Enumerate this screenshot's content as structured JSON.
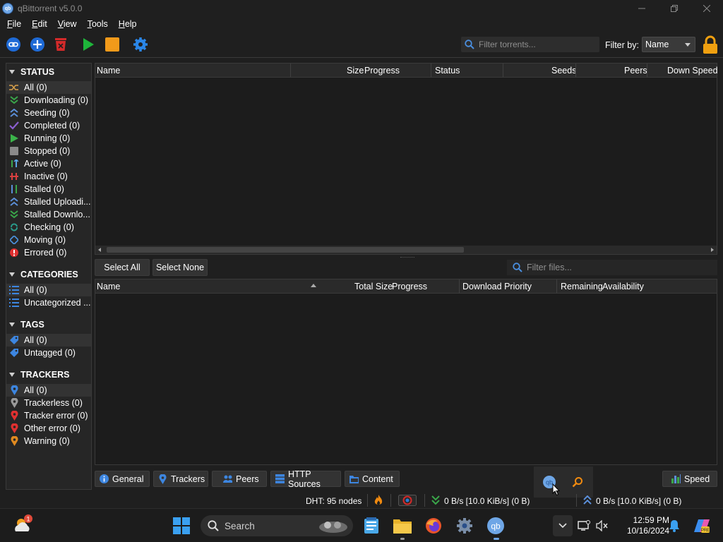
{
  "window": {
    "title": "qBittorrent v5.0.0",
    "logo_text": "qb"
  },
  "menu": [
    "File",
    "Edit",
    "View",
    "Tools",
    "Help"
  ],
  "toolbar": {
    "search_placeholder": "Filter torrents...",
    "filter_label": "Filter by:",
    "filter_value": "Name"
  },
  "sidebar": {
    "status_title": "STATUS",
    "status_items": [
      {
        "label": "All (0)",
        "icon": "shuffle-icon",
        "color": "#d8a04a"
      },
      {
        "label": "Downloading (0)",
        "icon": "download-chevrons-icon",
        "color": "#3aa64a"
      },
      {
        "label": "Seeding (0)",
        "icon": "upload-chevrons-icon",
        "color": "#5b8fd9"
      },
      {
        "label": "Completed (0)",
        "icon": "checkmark-icon",
        "color": "#8b5fd0"
      },
      {
        "label": "Running (0)",
        "icon": "play-icon",
        "color": "#3bb34a"
      },
      {
        "label": "Stopped (0)",
        "icon": "stop-icon",
        "color": "#8a8a8a"
      },
      {
        "label": "Active (0)",
        "icon": "active-arrows-icon",
        "color": "#5ba6e6"
      },
      {
        "label": "Inactive (0)",
        "icon": "inactive-arrows-icon",
        "color": "#d94040"
      },
      {
        "label": "Stalled (0)",
        "icon": "stalled-arrows-icon",
        "color": "#5b8fd9"
      },
      {
        "label": "Stalled Uploadi...",
        "icon": "stalled-upload-icon",
        "color": "#5b8fd9"
      },
      {
        "label": "Stalled Downlo...",
        "icon": "stalled-download-icon",
        "color": "#3aa64a"
      },
      {
        "label": "Checking (0)",
        "icon": "checking-icon",
        "color": "#2a9a8a"
      },
      {
        "label": "Moving (0)",
        "icon": "moving-icon",
        "color": "#4a8fd9"
      },
      {
        "label": "Errored (0)",
        "icon": "error-icon",
        "color": "#e03030"
      }
    ],
    "categories_title": "CATEGORIES",
    "category_items": [
      {
        "label": "All (0)",
        "icon": "list-icon"
      },
      {
        "label": "Uncategorized ...",
        "icon": "list-icon"
      }
    ],
    "tags_title": "TAGS",
    "tag_items": [
      {
        "label": "All (0)",
        "icon": "tag-icon"
      },
      {
        "label": "Untagged (0)",
        "icon": "tag-icon"
      }
    ],
    "trackers_title": "TRACKERS",
    "tracker_items": [
      {
        "label": "All (0)",
        "icon": "pin-icon",
        "color": "#3d86e0"
      },
      {
        "label": "Trackerless (0)",
        "icon": "pin-icon",
        "color": "#9a9a9a"
      },
      {
        "label": "Tracker error (0)",
        "icon": "pin-icon",
        "color": "#e03030"
      },
      {
        "label": "Other error (0)",
        "icon": "pin-icon",
        "color": "#e03030"
      },
      {
        "label": "Warning (0)",
        "icon": "pin-icon",
        "color": "#e08a20"
      }
    ]
  },
  "torrent_table": {
    "columns": [
      "Name",
      "Size",
      "Progress",
      "Status",
      "Seeds",
      "Peers",
      "Down Speed"
    ]
  },
  "files_pane": {
    "select_all": "Select All",
    "select_none": "Select None",
    "search_placeholder": "Filter files...",
    "columns": [
      "Name",
      "Total Size",
      "Progress",
      "Download Priority",
      "Remaining",
      "Availability"
    ]
  },
  "tabs": [
    "General",
    "Trackers",
    "Peers",
    "HTTP Sources",
    "Content"
  ],
  "speed_button": "Speed",
  "statusbar": {
    "dht": "DHT: 95 nodes",
    "download": "0 B/s [10.0 KiB/s] (0 B)",
    "upload": "0 B/s [10.0 KiB/s] (0 B)"
  },
  "taskbar": {
    "search_placeholder": "Search",
    "time": "12:59 PM",
    "date": "10/16/2024"
  }
}
